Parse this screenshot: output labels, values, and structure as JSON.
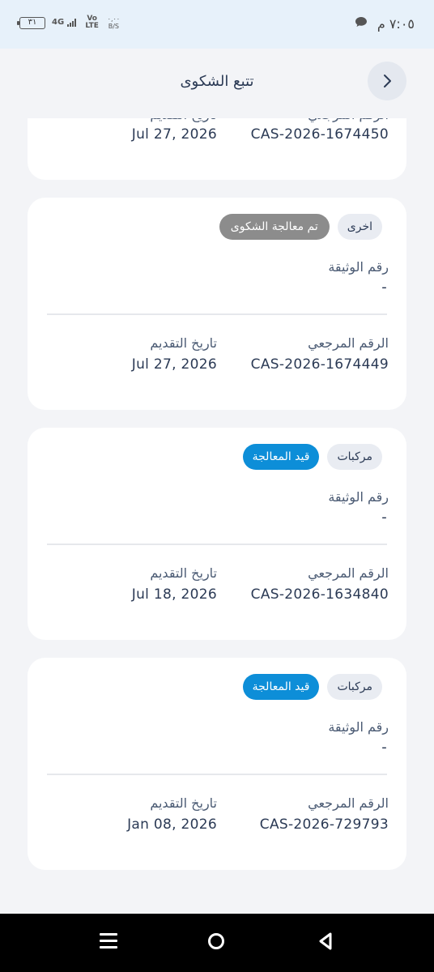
{
  "status_bar": {
    "time": "٧:٠٥ م",
    "battery": "٣١",
    "signal": "4G",
    "volte": "Vo LTE",
    "net_speed_value": "٠,٠٠",
    "net_speed_unit": "B/S"
  },
  "header": {
    "title": "تتبع الشكوى"
  },
  "labels": {
    "document_number": "رقم الوثيقة",
    "reference_number": "الرقم المرجعي",
    "submission_date": "تاريخ التقديم"
  },
  "partial_card": {
    "reference": "CAS-2026-1674450",
    "date": "Jul 27, 2026"
  },
  "cards": [
    {
      "category": "اخرى",
      "status": "تم معالجة الشكوى",
      "document": "-",
      "reference": "CAS-2026-1674449",
      "date": "Jul 27, 2026"
    },
    {
      "category": "مركبات",
      "status": "قيد المعالجة",
      "document": "-",
      "reference": "CAS-2026-1634840",
      "date": "Jul 18, 2026"
    },
    {
      "category": "مركبات",
      "status": "قيد المعالجة",
      "document": "-",
      "reference": "CAS-2026-729793",
      "date": "Jan 08, 2026"
    }
  ],
  "colors": {
    "status_resolved": "#8c8c8c",
    "status_in_progress": "#0d8ed8",
    "text_primary": "#2b3a55"
  },
  "icons": {
    "back": "chevron-right-icon",
    "message": "chat-bubble-icon",
    "nav_recent": "menu-icon",
    "nav_home": "circle-home-icon",
    "nav_back": "triangle-back-icon"
  }
}
